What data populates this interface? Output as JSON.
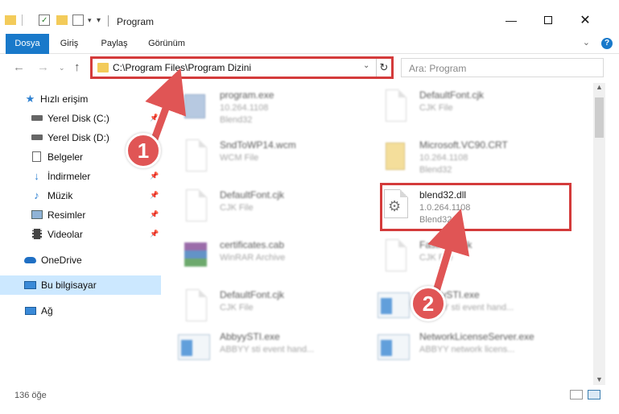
{
  "window": {
    "title": "Program",
    "minimize_icon": "minimize-icon",
    "maximize_icon": "maximize-icon",
    "close_icon": "close-icon"
  },
  "ribbon": {
    "tabs": [
      {
        "label": "Dosya",
        "active": true
      },
      {
        "label": "Giriş",
        "active": false
      },
      {
        "label": "Paylaş",
        "active": false
      },
      {
        "label": "Görünüm",
        "active": false
      }
    ],
    "help_label": "?"
  },
  "navigation": {
    "address": "C:\\Program Files\\Program Dizini",
    "search_placeholder": "Ara: Program"
  },
  "sidebar": {
    "items": [
      {
        "label": "Hızlı erişim",
        "icon": "star-icon"
      },
      {
        "label": "Yerel Disk (C:)",
        "icon": "drive-icon",
        "pinned": true
      },
      {
        "label": "Yerel Disk (D:)",
        "icon": "drive-icon"
      },
      {
        "label": "Belgeler",
        "icon": "documents-icon"
      },
      {
        "label": "İndirmeler",
        "icon": "download-icon",
        "pinned": true
      },
      {
        "label": "Müzik",
        "icon": "music-icon",
        "pinned": true
      },
      {
        "label": "Resimler",
        "icon": "pictures-icon",
        "pinned": true
      },
      {
        "label": "Videolar",
        "icon": "video-icon",
        "pinned": true
      },
      {
        "label": "OneDrive",
        "icon": "cloud-icon"
      },
      {
        "label": "Bu bilgisayar",
        "icon": "computer-icon",
        "selected": true
      },
      {
        "label": "Ağ",
        "icon": "network-icon"
      }
    ]
  },
  "files": [
    {
      "name": "program.exe",
      "sub1": "10.264.1108",
      "sub2": "Blend32",
      "icon": "installer-icon"
    },
    {
      "name": "DefaultFont.cjk",
      "sub1": "CJK File",
      "sub2": "",
      "icon": "document-icon"
    },
    {
      "name": "SndToWP14.wcm",
      "sub1": "WCM File",
      "sub2": "",
      "icon": "document-icon"
    },
    {
      "name": "Microsoft.VC90.CRT",
      "sub1": "10.264.1108",
      "sub2": "Blend32",
      "icon": "folder-zip-icon"
    },
    {
      "name": "DefaultFont.cjk",
      "sub1": "CJK File",
      "sub2": "",
      "icon": "document-icon"
    },
    {
      "name": "blend32.dll",
      "sub1": "1.0.264.1108",
      "sub2": "Blend32",
      "icon": "dll-gear-icon",
      "highlighted": true
    },
    {
      "name": "certificates.cab",
      "sub1": "WinRAR Archive",
      "sub2": "",
      "icon": "archive-icon"
    },
    {
      "name": "FastFont.cjk",
      "sub1": "CJK File",
      "sub2": "",
      "icon": "document-icon"
    },
    {
      "name": "DefaultFont.cjk",
      "sub1": "CJK File",
      "sub2": "",
      "icon": "document-icon"
    },
    {
      "name": "AbbyySTI.exe",
      "sub1": "ABBYY sti event hand...",
      "sub2": "",
      "icon": "exe-window-icon"
    },
    {
      "name": "AbbyySTI.exe",
      "sub1": "ABBYY sti event hand...",
      "sub2": "",
      "icon": "exe-window-icon"
    },
    {
      "name": "NetworkLicenseServer.exe",
      "sub1": "ABBYY network licens...",
      "sub2": "",
      "icon": "exe-window-icon"
    }
  ],
  "status": {
    "count": "136 öğe"
  },
  "annotations": {
    "step1": "1",
    "step2": "2",
    "color": "#e05555"
  }
}
